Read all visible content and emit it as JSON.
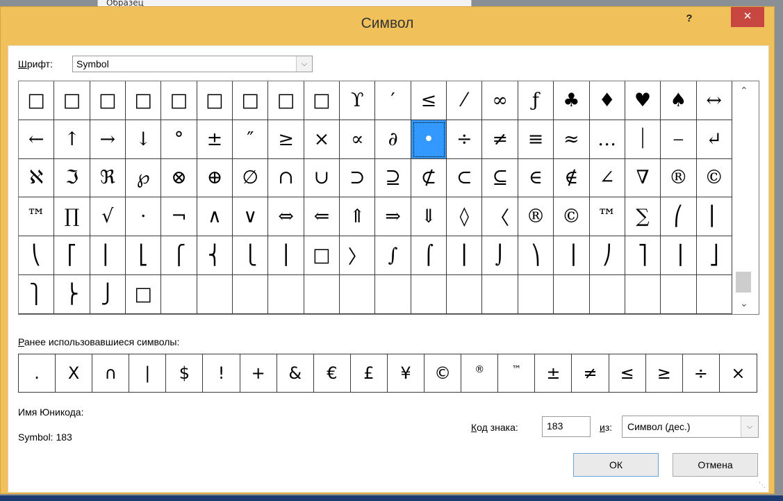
{
  "background": {
    "doc_sample_text": "Образец"
  },
  "dialog": {
    "title": "Символ",
    "help": "?",
    "close": "✕"
  },
  "font": {
    "label_first": "Ш",
    "label_rest": "рифт:",
    "value": "Symbol"
  },
  "symbols": [
    [
      "□",
      "□",
      "□",
      "□",
      "□",
      "□",
      "□",
      "□",
      "□",
      "ϒ",
      "′",
      "≤",
      "⁄",
      "∞",
      "ƒ",
      "♣",
      "♦",
      "♥",
      "♠",
      "↔"
    ],
    [
      "←",
      "↑",
      "→",
      "↓",
      "°",
      "±",
      "″",
      "≥",
      "×",
      "∝",
      "∂",
      "•",
      "÷",
      "≠",
      "≡",
      "≈",
      "…",
      "⏐",
      "⎯",
      "↵"
    ],
    [
      "ℵ",
      "ℑ",
      "ℜ",
      "℘",
      "⊗",
      "⊕",
      "∅",
      "∩",
      "∪",
      "⊃",
      "⊇",
      "⊄",
      "⊂",
      "⊆",
      "∈",
      "∉",
      "∠",
      "∇",
      "®",
      "©"
    ],
    [
      "™",
      "∏",
      "√",
      "⋅",
      "¬",
      "∧",
      "∨",
      "⇔",
      "⇐",
      "⇑",
      "⇒",
      "⇓",
      "◊",
      "〈",
      "®",
      "©",
      "™",
      "∑",
      "⎛",
      "⎜"
    ],
    [
      "⎝",
      "⎡",
      "⎢",
      "⎣",
      "⎧",
      "⎨",
      "⎩",
      "⎪",
      "□",
      "〉",
      "∫",
      "⌠",
      "⎮",
      "⌡",
      "⎞",
      "⎟",
      "⎠",
      "⎤",
      "⎥",
      "⎦"
    ],
    [
      "⎫",
      "⎬",
      "⎭",
      "□",
      "",
      "",
      "",
      "",
      "",
      "",
      "",
      "",
      "",
      "",
      "",
      "",
      "",
      "",
      "",
      ""
    ]
  ],
  "selected": {
    "row": 1,
    "col": 11
  },
  "recent": {
    "label_first": "Р",
    "label_rest": "анее использовавшиеся символы:",
    "items": [
      ".",
      "X",
      "∩",
      "|",
      "$",
      "!",
      "+",
      "&",
      "€",
      "£",
      "¥",
      "©",
      "®",
      "™",
      "±",
      "≠",
      "≤",
      "≥",
      "÷",
      "×"
    ]
  },
  "unicode_name": {
    "label": "Имя Юникода:",
    "value": "Symbol: 183"
  },
  "char_code": {
    "label_first": "К",
    "label_rest": "од знака:",
    "value": "183"
  },
  "from": {
    "label_first": "и",
    "label_rest": "з:",
    "value": "Символ (дес.)"
  },
  "buttons": {
    "ok": "ОК",
    "cancel": "Отмена"
  },
  "icons": {
    "scroll_up": "chevron-up-icon",
    "scroll_down": "chevron-down-icon",
    "dropdown": "chevron-down-icon"
  }
}
